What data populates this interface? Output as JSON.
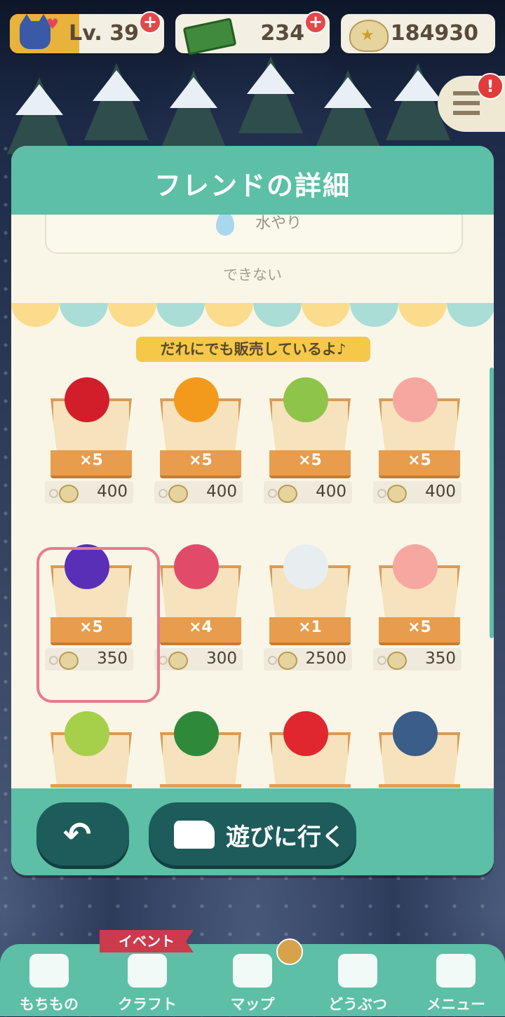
{
  "status": {
    "level_label": "Lv. 39",
    "level_progress": 0.45,
    "tickets": "234",
    "bells": "184930",
    "heart_icon": "heart-icon",
    "plus_icon": "plus-icon"
  },
  "menu_alert": "!",
  "modal": {
    "title": "フレンドの詳細",
    "water_label": "水やり",
    "cannot_label": "できない",
    "banner": "だれにでも販売しているよ♪",
    "awning_colors": [
      "#fbdc8d",
      "#a9ddd6"
    ],
    "items": [
      {
        "name": "cherry",
        "qty": "×5",
        "price": "400",
        "color": "#d21e2b"
      },
      {
        "name": "orange",
        "qty": "×5",
        "price": "400",
        "color": "#f39a1c"
      },
      {
        "name": "pear",
        "qty": "×5",
        "price": "400",
        "color": "#8fc44a"
      },
      {
        "name": "peach",
        "qty": "×5",
        "price": "400",
        "color": "#f6a8a0"
      },
      {
        "name": "grapes",
        "qty": "×5",
        "price": "350",
        "color": "#5a2fb8"
      },
      {
        "name": "coral",
        "qty": "×4",
        "price": "300",
        "color": "#e24a6a"
      },
      {
        "name": "pufferfish",
        "qty": "×1",
        "price": "2500",
        "color": "#e8eef0"
      },
      {
        "name": "peach",
        "qty": "×5",
        "price": "350",
        "color": "#f6a8a0"
      },
      {
        "name": "pear",
        "qty": "",
        "price": "",
        "color": "#a6cf4a"
      },
      {
        "name": "beetle",
        "qty": "",
        "price": "",
        "color": "#2e8a3a"
      },
      {
        "name": "apple",
        "qty": "",
        "price": "",
        "color": "#e0262e"
      },
      {
        "name": "tuna",
        "qty": "",
        "price": "",
        "color": "#3a5d8a"
      }
    ],
    "back_label": "↶",
    "go_label": "遊びに行く"
  },
  "nav": {
    "event_tag": "イベント",
    "items": [
      {
        "label": "もちもの",
        "icon": "bag-icon"
      },
      {
        "label": "クラフト",
        "icon": "hammer-icon"
      },
      {
        "label": "マップ",
        "icon": "map-icon"
      },
      {
        "label": "どうぶつ",
        "icon": "animal-icon"
      },
      {
        "label": "メニュー",
        "icon": "grid-icon"
      }
    ]
  }
}
